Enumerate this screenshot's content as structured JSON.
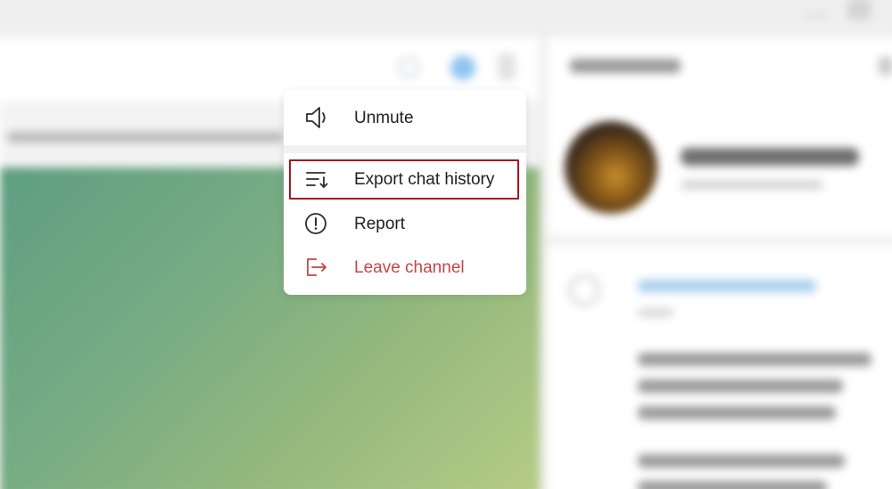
{
  "menu": {
    "items": [
      {
        "id": "unmute",
        "label": "Unmute",
        "icon": "speaker-icon"
      },
      {
        "id": "export",
        "label": "Export chat history",
        "icon": "export-history-icon",
        "highlighted": true
      },
      {
        "id": "report",
        "label": "Report",
        "icon": "report-exclamation-icon"
      },
      {
        "id": "leave",
        "label": "Leave channel",
        "icon": "leave-icon",
        "color": "#c24646"
      }
    ]
  },
  "colors": {
    "danger": "#c24646",
    "highlight_border": "#a4151f",
    "menu_background": "#ffffff",
    "chat_background": "#7aad85"
  }
}
